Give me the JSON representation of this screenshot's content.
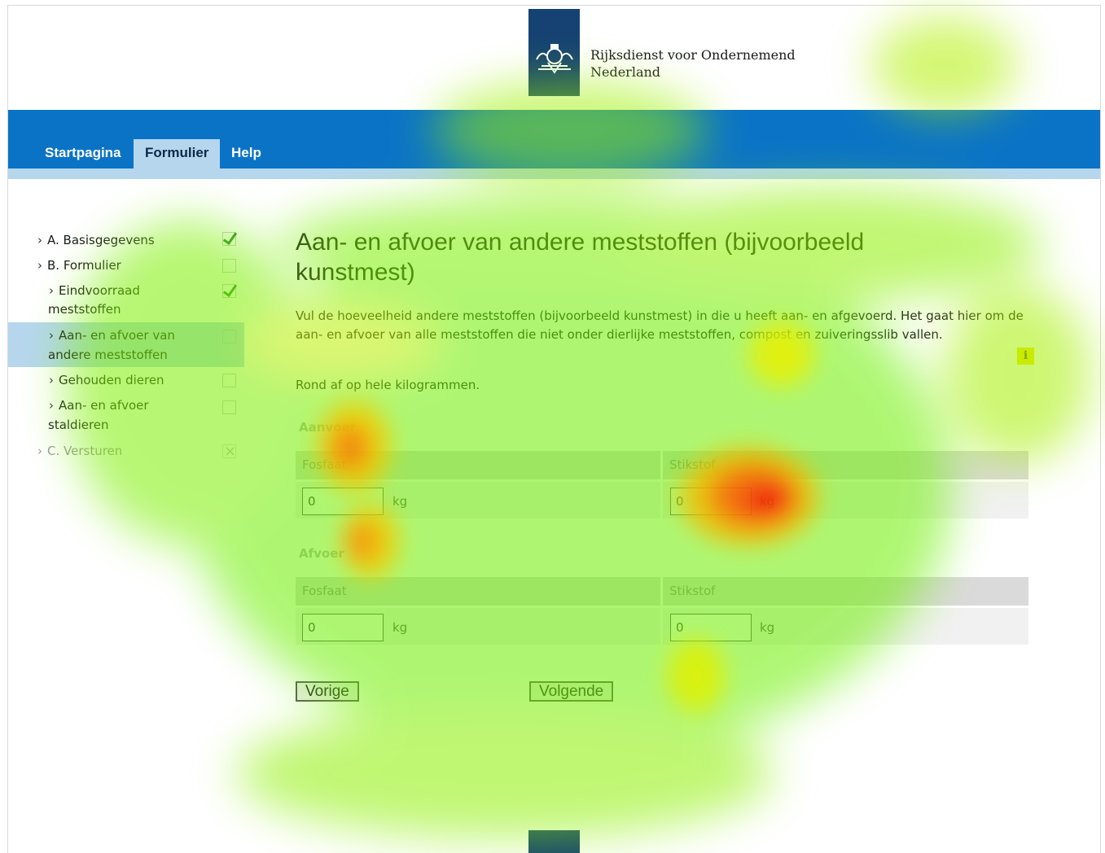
{
  "header": {
    "brand_line1": "Rijksdienst voor Ondernemend",
    "brand_line2": "Nederland"
  },
  "nav": {
    "tabs": [
      {
        "label": "Startpagina",
        "active": false
      },
      {
        "label": "Formulier",
        "active": true
      },
      {
        "label": "Help",
        "active": false
      }
    ]
  },
  "sidebar": {
    "items": [
      {
        "line1": "A. Basisgegevens",
        "line2": "",
        "status": "checked"
      },
      {
        "line1": "B. Formulier",
        "line2": "",
        "status": "empty"
      },
      {
        "line1": "Eindvoorraad",
        "line2": "meststoffen",
        "status": "checked"
      },
      {
        "line1": "Aan- en afvoer van",
        "line2": "andere meststoffen",
        "status": "empty"
      },
      {
        "line1": "Gehouden dieren",
        "line2": "",
        "status": "empty"
      },
      {
        "line1": "Aan- en afvoer",
        "line2": "staldieren",
        "status": "empty"
      },
      {
        "line1": "C. Versturen",
        "line2": "",
        "status": "disabled"
      }
    ]
  },
  "main": {
    "title_line1": "Aan- en afvoer van andere meststoffen (bijvoorbeeld",
    "title_line2": "kunstmest)",
    "intro": "Vul de hoeveelheid andere meststoffen (bijvoorbeeld kunstmest) in die u heeft aan- en afgevoerd. Het gaat hier om de aan- en afvoer van alle meststoffen die niet onder dierlijke meststoffen, compost en zuiveringsslib vallen.",
    "hint": "Rond af op hele kilogrammen.",
    "info_icon_label": "i",
    "aanvoer": {
      "label": "Aanvoer",
      "fosfaat_label": "Fosfaat",
      "fosfaat_value": "0",
      "stikstof_label": "Stikstof",
      "stikstof_value": "0"
    },
    "afvoer": {
      "label": "Afvoer",
      "fosfaat_label": "Fosfaat",
      "fosfaat_value": "0",
      "stikstof_label": "Stikstof",
      "stikstof_value": "0"
    },
    "unit": "kg",
    "prev_button": "Vorige",
    "next_button": "Volgende"
  }
}
